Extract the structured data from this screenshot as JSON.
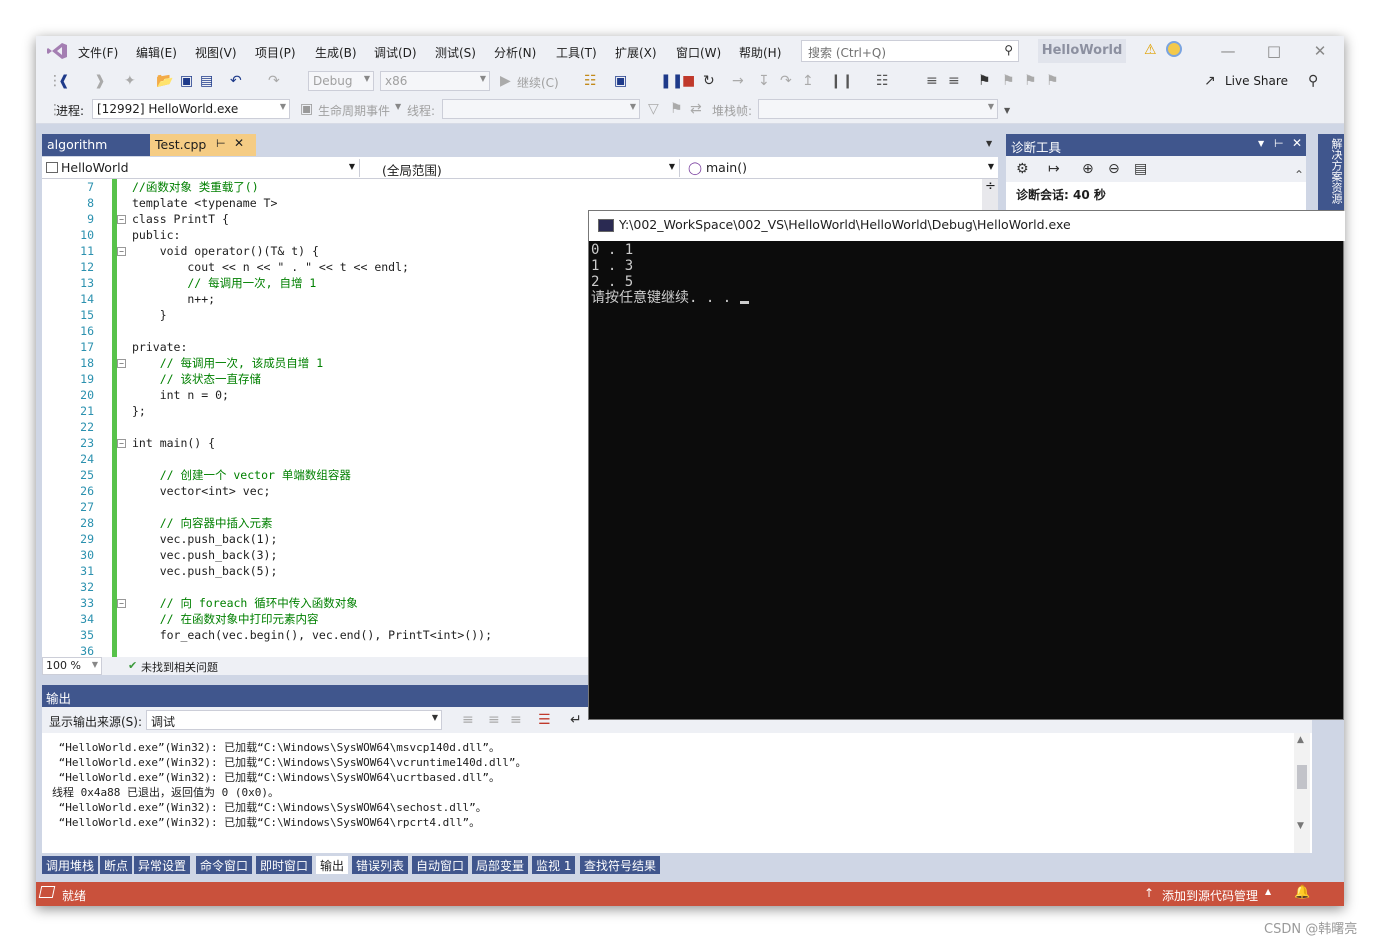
{
  "menu": [
    "文件(F)",
    "编辑(E)",
    "视图(V)",
    "项目(P)",
    "生成(B)",
    "调试(D)",
    "测试(S)",
    "分析(N)",
    "工具(T)",
    "扩展(X)",
    "窗口(W)",
    "帮助(H)"
  ],
  "search": {
    "placeholder": "搜索 (Ctrl+Q)"
  },
  "solution_badge": "HelloWorld",
  "toolbar": {
    "config": "Debug",
    "platform": "x86",
    "continue_label": "继续(C)",
    "live_share": "Live Share",
    "process_label": "进程:",
    "process_value": "[12992] HelloWorld.exe",
    "lifecycle_label": "生命周期事件",
    "thread_label": "线程:",
    "stackframe_label": "堆栈帧:"
  },
  "doc_tabs": {
    "inactive": "algorithm",
    "active": "Test.cpp"
  },
  "navbar": {
    "project": "HelloWorld",
    "scope": "(全局范围)",
    "member": "main()"
  },
  "code_lines": [
    {
      "n": "7",
      "t": "//函数对象 类重载了()"
    },
    {
      "n": "8",
      "t": "template <typename T>"
    },
    {
      "n": "9",
      "t": "class PrintT {"
    },
    {
      "n": "10",
      "t": "public:"
    },
    {
      "n": "11",
      "t": "    void operator()(T& t) {"
    },
    {
      "n": "12",
      "t": "        cout << n << \" . \" << t << endl;"
    },
    {
      "n": "13",
      "t": "        // 每调用一次, 自增 1"
    },
    {
      "n": "14",
      "t": "        n++;"
    },
    {
      "n": "15",
      "t": "    }"
    },
    {
      "n": "16",
      "t": ""
    },
    {
      "n": "17",
      "t": "private:"
    },
    {
      "n": "18",
      "t": "    // 每调用一次, 该成员自增 1"
    },
    {
      "n": "19",
      "t": "    // 该状态一直存储"
    },
    {
      "n": "20",
      "t": "    int n = 0;"
    },
    {
      "n": "21",
      "t": "};"
    },
    {
      "n": "22",
      "t": ""
    },
    {
      "n": "23",
      "t": "int main() {"
    },
    {
      "n": "24",
      "t": ""
    },
    {
      "n": "25",
      "t": "    // 创建一个 vector 单端数组容器"
    },
    {
      "n": "26",
      "t": "    vector<int> vec;"
    },
    {
      "n": "27",
      "t": ""
    },
    {
      "n": "28",
      "t": "    // 向容器中插入元素"
    },
    {
      "n": "29",
      "t": "    vec.push_back(1);"
    },
    {
      "n": "30",
      "t": "    vec.push_back(3);"
    },
    {
      "n": "31",
      "t": "    vec.push_back(5);"
    },
    {
      "n": "32",
      "t": ""
    },
    {
      "n": "33",
      "t": "    // 向 foreach 循环中传入函数对象"
    },
    {
      "n": "34",
      "t": "    // 在函数对象中打印元素内容"
    },
    {
      "n": "35",
      "t": "    for_each(vec.begin(), vec.end(), PrintT<int>());"
    },
    {
      "n": "36",
      "t": ""
    }
  ],
  "editor_status": {
    "zoom": "100 %",
    "issues": "未找到相关问题"
  },
  "diag": {
    "title": "诊断工具",
    "session": "诊断会话: 40 秒"
  },
  "side_strip": "解决方案资源",
  "output": {
    "title": "输出",
    "source_label": "显示输出来源(S):",
    "source_value": "调试",
    "lines": [
      " “HelloWorld.exe”(Win32): 已加载“C:\\Windows\\SysWOW64\\msvcp140d.dll”。",
      " “HelloWorld.exe”(Win32): 已加载“C:\\Windows\\SysWOW64\\vcruntime140d.dll”。",
      " “HelloWorld.exe”(Win32): 已加载“C:\\Windows\\SysWOW64\\ucrtbased.dll”。",
      "线程 0x4a88 已退出，返回值为 0 (0x0)。",
      " “HelloWorld.exe”(Win32): 已加载“C:\\Windows\\SysWOW64\\sechost.dll”。",
      " “HelloWorld.exe”(Win32): 已加载“C:\\Windows\\SysWOW64\\rpcrt4.dll”。"
    ]
  },
  "bottom_tabs": [
    "调用堆栈",
    "断点",
    "异常设置",
    "命令窗口",
    "即时窗口",
    "输出",
    "错误列表",
    "自动窗口",
    "局部变量",
    "监视 1",
    "查找符号结果"
  ],
  "status": {
    "ready": "就绪",
    "source_control": "添加到源代码管理"
  },
  "console": {
    "title": "Y:\\002_WorkSpace\\002_VS\\HelloWorld\\HelloWorld\\Debug\\HelloWorld.exe",
    "lines": [
      "0 . 1",
      "1 . 3",
      "2 . 5",
      "请按任意键继续. . . "
    ]
  },
  "watermark": "CSDN @韩曙亮",
  "colors": {
    "accent": "#40568d",
    "status": "#c9513c",
    "active_tab": "#f5cc84",
    "console_bg": "#0c0c0c"
  }
}
